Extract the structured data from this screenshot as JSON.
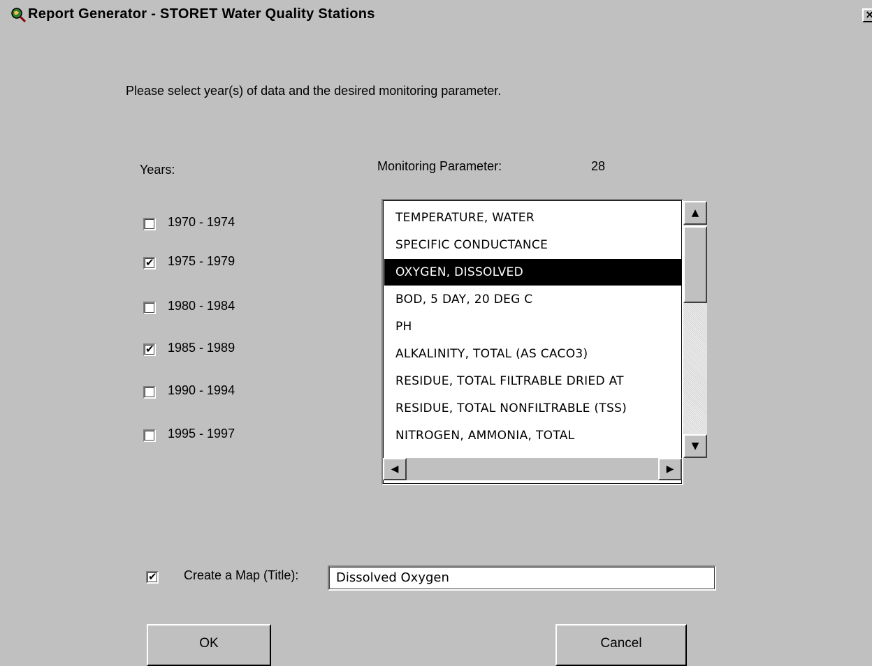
{
  "window": {
    "title": "Report Generator - STORET Water Quality Stations",
    "icon": "magnifier-globe-icon",
    "close_label": "×"
  },
  "instructions": "Please select year(s) of data and the desired monitoring parameter.",
  "years": {
    "label": "Years:",
    "options": [
      {
        "label": "1970 - 1974",
        "checked": false
      },
      {
        "label": "1975 - 1979",
        "checked": true
      },
      {
        "label": "1980 - 1984",
        "checked": false
      },
      {
        "label": "1985 - 1989",
        "checked": true
      },
      {
        "label": "1990 - 1994",
        "checked": false
      },
      {
        "label": "1995 - 1997",
        "checked": false
      }
    ]
  },
  "parameter": {
    "label": "Monitoring Parameter:",
    "count": "28",
    "selected": "OXYGEN, DISSOLVED",
    "items": [
      "TEMPERATURE, WATER",
      "SPECIFIC CONDUCTANCE",
      "OXYGEN, DISSOLVED",
      "BOD, 5 DAY, 20 DEG C",
      "PH",
      "ALKALINITY, TOTAL (AS CACO3)",
      "RESIDUE, TOTAL FILTRABLE  DRIED AT",
      "RESIDUE, TOTAL NONFILTRABLE (TSS)",
      "NITROGEN, AMMONIA, TOTAL"
    ]
  },
  "map": {
    "checked": true,
    "label": "Create a Map (Title):",
    "title_value": "Dissolved Oxygen"
  },
  "buttons": {
    "ok": "OK",
    "cancel": "Cancel"
  },
  "check_glyph": "✔",
  "scroll_glyphs": {
    "up": "▲",
    "down": "▼",
    "left": "◀",
    "right": "▶"
  }
}
